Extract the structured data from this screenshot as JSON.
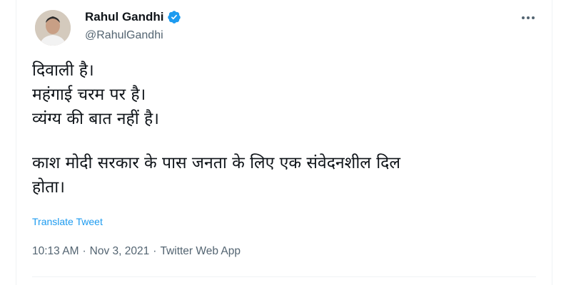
{
  "tweet": {
    "author": {
      "name": "Rahul Gandhi",
      "handle": "@RahulGandhi",
      "verified": true,
      "verified_color": "#1d9bf0"
    },
    "text_lines": [
      "दिवाली है।",
      "महंगाई चरम पर है।",
      "व्यंग्य की बात नहीं है।",
      "",
      "काश मोदी सरकार के पास जनता के लिए एक संवेदनशील दिल",
      "होता।"
    ],
    "translate_label": "Translate Tweet",
    "time": "10:13 AM",
    "date": "Nov 3, 2021",
    "source": "Twitter Web App",
    "separator": "·",
    "more_icon": "more-horizontal-icon",
    "link_color": "#1d9bf0"
  }
}
